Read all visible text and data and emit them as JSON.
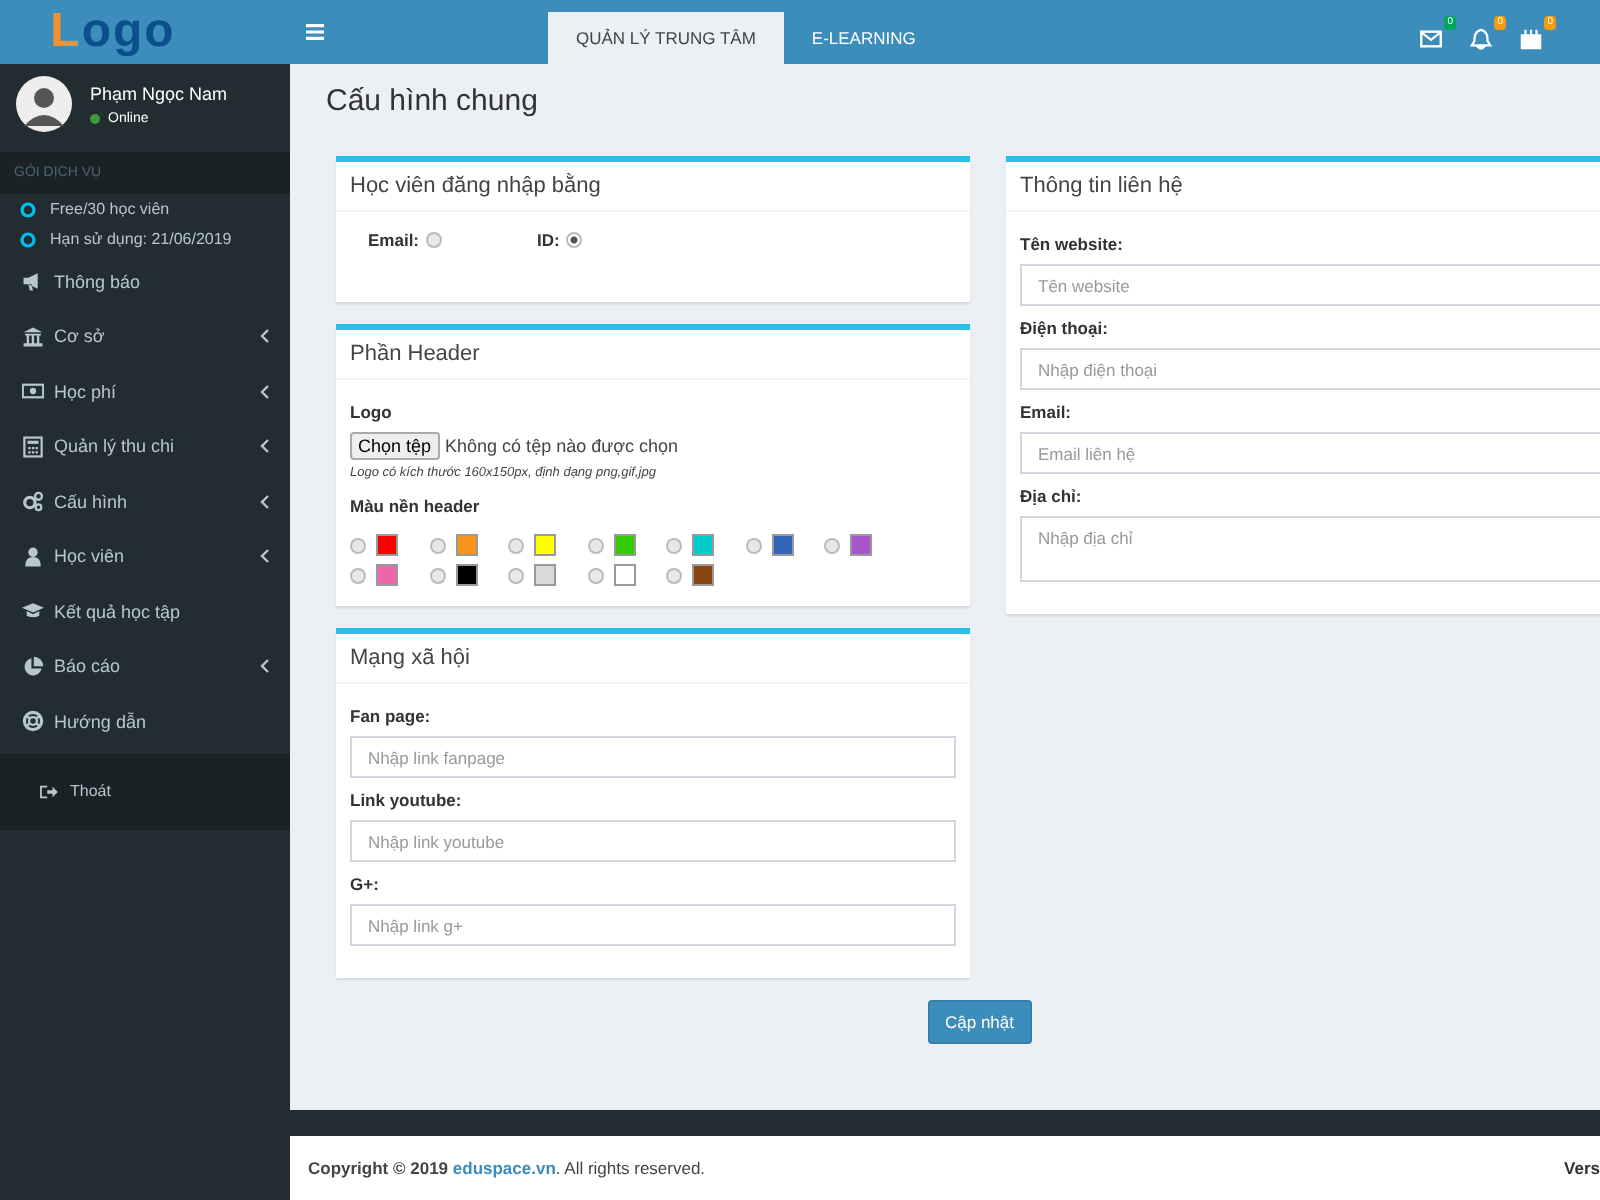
{
  "logo": "Logo",
  "user": {
    "name": "Phạm Ngọc Nam",
    "status": "Online",
    "online": true
  },
  "sidebar": {
    "section": "GÓI DỊCH VỤ",
    "plan": [
      {
        "label": "Free/30 học viên"
      },
      {
        "label": "Hạn sử dụng: 21/06/2019"
      }
    ],
    "items": [
      {
        "label": "Thông báo",
        "expandable": false
      },
      {
        "label": "Cơ sở",
        "expandable": true
      },
      {
        "label": "Học phí",
        "expandable": true
      },
      {
        "label": "Quản lý thu chi",
        "expandable": true
      },
      {
        "label": "Cấu hình",
        "expandable": true
      },
      {
        "label": "Học viên",
        "expandable": true
      },
      {
        "label": "Kết quả học tập",
        "expandable": false
      },
      {
        "label": "Báo cáo",
        "expandable": true
      },
      {
        "label": "Hướng dẫn",
        "expandable": false
      }
    ],
    "logout": "Thoát"
  },
  "tabs": [
    {
      "label": "QUẢN LÝ TRUNG TÂM",
      "selected": true
    },
    {
      "label": "E-LEARNING",
      "selected": false
    }
  ],
  "notifications": [
    {
      "count": "0",
      "color": "#00a65a"
    },
    {
      "count": "0",
      "color": "#f39c12"
    },
    {
      "count": "0",
      "color": "#f39c12"
    }
  ],
  "page_title": "Cấu hình chung",
  "login_box": {
    "title": "Học viên đăng nhập bằng",
    "options": [
      {
        "label": "Email:",
        "selected": false
      },
      {
        "label": "ID:",
        "selected": true
      }
    ]
  },
  "header_box": {
    "title": "Phần Header",
    "logo_label": "Logo",
    "file_button": "Chọn tệp",
    "file_status": "Không có tệp nào được chọn",
    "hint": "Logo có kích thước 160x150px, định dạng png,gif,jpg",
    "color_label": "Màu nền header",
    "colors": [
      {
        "color": "#ff0000",
        "selected": false
      },
      {
        "color": "#f7941d",
        "selected": false
      },
      {
        "color": "#ffff00",
        "selected": false
      },
      {
        "color": "#33cc00",
        "selected": false
      },
      {
        "color": "#00cccc",
        "selected": false
      },
      {
        "color": "#3366bb",
        "selected": false
      },
      {
        "color": "#aa55cc",
        "selected": false
      },
      {
        "color": "#ee66aa",
        "selected": false
      },
      {
        "color": "#000000",
        "selected": false
      },
      {
        "color": "#d9d9d9",
        "selected": false
      },
      {
        "color": "#ffffff",
        "selected": false
      },
      {
        "color": "#8b4513",
        "selected": false
      }
    ]
  },
  "social_box": {
    "title": "Mạng xã hội",
    "fields": [
      {
        "label": "Fan page:",
        "placeholder": "Nhập link fanpage"
      },
      {
        "label": "Link youtube:",
        "placeholder": "Nhập link youtube"
      },
      {
        "label": "G+:",
        "placeholder": "Nhập link g+"
      }
    ]
  },
  "contact_box": {
    "title": "Thông tin liên hệ",
    "fields": [
      {
        "label": "Tên website:",
        "placeholder": "Tên website",
        "kind": "input"
      },
      {
        "label": "Điện thoại:",
        "placeholder": "Nhập điện thoại",
        "kind": "input"
      },
      {
        "label": "Email:",
        "placeholder": "Email liên hệ",
        "kind": "input"
      },
      {
        "label": "Địa chỉ:",
        "placeholder": "Nhập địa chỉ",
        "kind": "textarea"
      }
    ]
  },
  "submit": "Cập nhật",
  "footer": {
    "copyright": "**Copyright © 2019** ",
    "link": "eduspace.vn",
    "rest": ". All rights reserved.",
    "version": "Vers"
  }
}
